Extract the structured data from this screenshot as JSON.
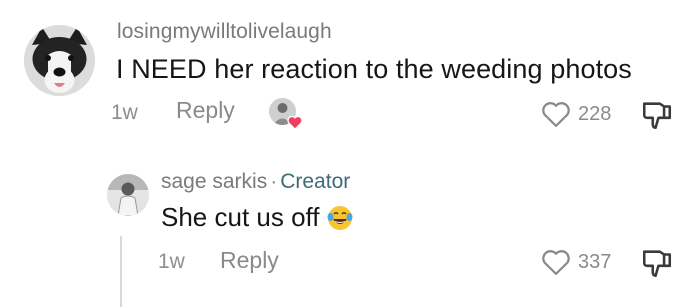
{
  "comments": [
    {
      "username": "losingmywilltolivelaugh",
      "text": "I NEED her reaction to the weeding photos",
      "time": "1w",
      "reply_label": "Reply",
      "likes": "228",
      "creator_liked": true,
      "avatar_icon": "husky-dog-avatar",
      "like_icon": "heart-outline-icon",
      "dislike_icon": "thumbs-down-icon",
      "creator_like_icon": "creator-heart-badge-icon"
    },
    {
      "username": "sage sarkis",
      "separator": "·",
      "badge": "Creator",
      "text": "She cut us off",
      "emoji": "😂",
      "emoji_icon": "laughing-tears-emoji",
      "time": "1w",
      "reply_label": "Reply",
      "likes": "337",
      "avatar_icon": "person-avatar",
      "like_icon": "heart-outline-icon",
      "dislike_icon": "thumbs-down-icon"
    }
  ],
  "colors": {
    "text": "#161616",
    "muted": "#8a8a8a",
    "creator": "#3d6b79",
    "heart_badge": "#f23d5e"
  }
}
